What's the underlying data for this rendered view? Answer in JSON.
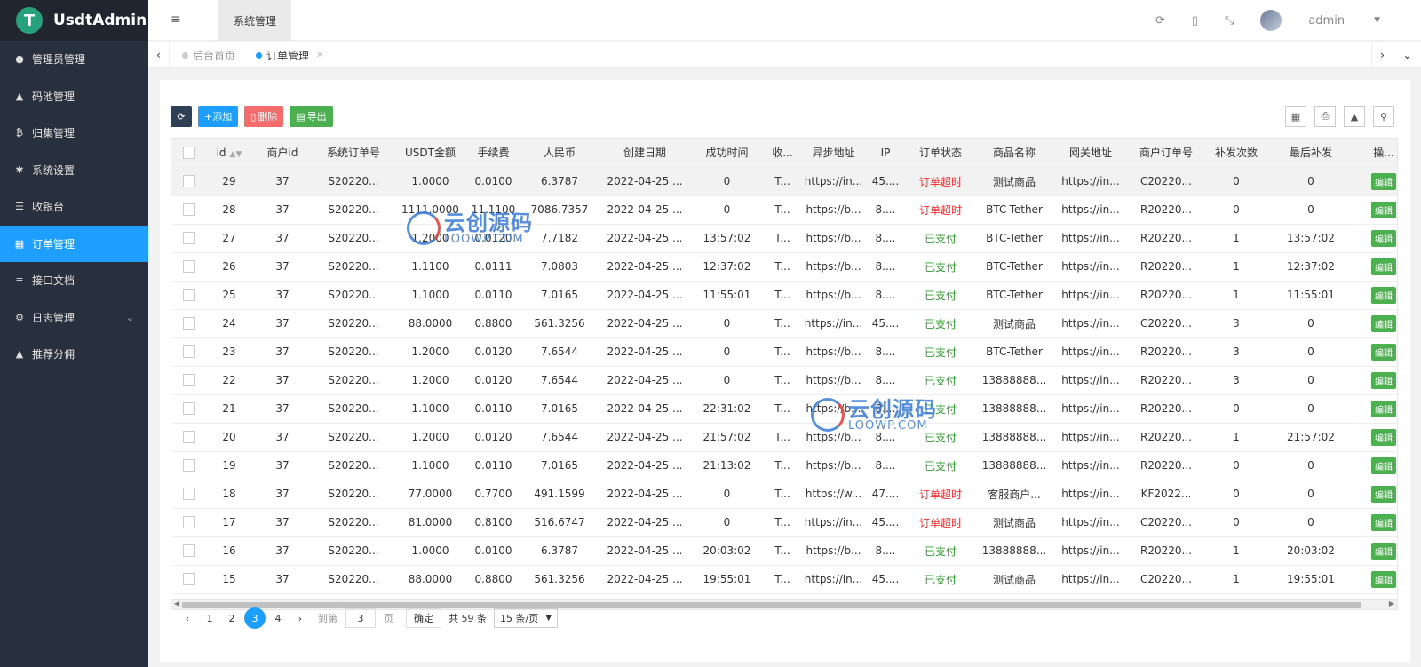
{
  "app": {
    "logo_letter": "T",
    "title": "UsdtAdmin"
  },
  "sidebar": {
    "items": [
      {
        "label": "管理员管理",
        "icon": "user-icon"
      },
      {
        "label": "码池管理",
        "icon": "android-icon"
      },
      {
        "label": "归集管理",
        "icon": "bitcoin-icon"
      },
      {
        "label": "系统设置",
        "icon": "asterisk-icon"
      },
      {
        "label": "收银台",
        "icon": "list-icon"
      },
      {
        "label": "订单管理",
        "icon": "calculator-icon"
      },
      {
        "label": "接口文档",
        "icon": "align-left-icon"
      },
      {
        "label": "日志管理",
        "icon": "gear-icon"
      },
      {
        "label": "推荐分佣",
        "icon": "android-icon"
      }
    ]
  },
  "topbar": {
    "active_tab": "系统管理",
    "username": "admin"
  },
  "tabs": [
    {
      "label": "后台首页"
    },
    {
      "label": "订单管理"
    }
  ],
  "toolbar": {
    "add": "添加",
    "delete": "删除",
    "export": "导出"
  },
  "table": {
    "columns": [
      "id",
      "商户id",
      "系统订单号",
      "USDT金额",
      "手续费",
      "人民币",
      "创建日期",
      "成功时间",
      "收...",
      "异步地址",
      "IP",
      "订单状态",
      "商品名称",
      "网关地址",
      "商户订单号",
      "补发次数",
      "最后补发",
      "操..."
    ],
    "rows": [
      [
        "29",
        "37",
        "S20220...",
        "1.0000",
        "0.0100",
        "6.3787",
        "2022-04-25 ...",
        "0",
        "T...",
        "https://in...",
        "45....",
        "订单超时",
        "测试商品",
        "https://in...",
        "C20220...",
        "0",
        "0"
      ],
      [
        "28",
        "37",
        "S20220...",
        "1111.0000",
        "11.1100",
        "7086.7357",
        "2022-04-25 ...",
        "0",
        "T...",
        "https://b...",
        "8....",
        "订单超时",
        "BTC-Tether",
        "https://in...",
        "R20220...",
        "0",
        "0"
      ],
      [
        "27",
        "37",
        "S20220...",
        "1.2000",
        "0.0120",
        "7.7182",
        "2022-04-25 ...",
        "13:57:02",
        "T...",
        "https://b...",
        "8....",
        "已支付",
        "BTC-Tether",
        "https://in...",
        "R20220...",
        "1",
        "13:57:02"
      ],
      [
        "26",
        "37",
        "S20220...",
        "1.1100",
        "0.0111",
        "7.0803",
        "2022-04-25 ...",
        "12:37:02",
        "T...",
        "https://b...",
        "8....",
        "已支付",
        "BTC-Tether",
        "https://in...",
        "R20220...",
        "1",
        "12:37:02"
      ],
      [
        "25",
        "37",
        "S20220...",
        "1.1000",
        "0.0110",
        "7.0165",
        "2022-04-25 ...",
        "11:55:01",
        "T...",
        "https://b...",
        "8....",
        "已支付",
        "BTC-Tether",
        "https://in...",
        "R20220...",
        "1",
        "11:55:01"
      ],
      [
        "24",
        "37",
        "S20220...",
        "88.0000",
        "0.8800",
        "561.3256",
        "2022-04-25 ...",
        "0",
        "T...",
        "https://in...",
        "45....",
        "已支付",
        "测试商品",
        "https://in...",
        "C20220...",
        "3",
        "0"
      ],
      [
        "23",
        "37",
        "S20220...",
        "1.2000",
        "0.0120",
        "7.6544",
        "2022-04-25 ...",
        "0",
        "T...",
        "https://b...",
        "8....",
        "已支付",
        "BTC-Tether",
        "https://in...",
        "R20220...",
        "3",
        "0"
      ],
      [
        "22",
        "37",
        "S20220...",
        "1.2000",
        "0.0120",
        "7.6544",
        "2022-04-25 ...",
        "0",
        "T...",
        "https://b...",
        "8....",
        "已支付",
        "13888888...",
        "https://in...",
        "R20220...",
        "3",
        "0"
      ],
      [
        "21",
        "37",
        "S20220...",
        "1.1000",
        "0.0110",
        "7.0165",
        "2022-04-25 ...",
        "22:31:02",
        "T...",
        "https://b...",
        "8....",
        "已支付",
        "13888888...",
        "https://in...",
        "R20220...",
        "0",
        "0"
      ],
      [
        "20",
        "37",
        "S20220...",
        "1.2000",
        "0.0120",
        "7.6544",
        "2022-04-25 ...",
        "21:57:02",
        "T...",
        "https://b...",
        "8....",
        "已支付",
        "13888888...",
        "https://in...",
        "R20220...",
        "1",
        "21:57:02"
      ],
      [
        "19",
        "37",
        "S20220...",
        "1.1000",
        "0.0110",
        "7.0165",
        "2022-04-25 ...",
        "21:13:02",
        "T...",
        "https://b...",
        "8....",
        "已支付",
        "13888888...",
        "https://in...",
        "R20220...",
        "0",
        "0"
      ],
      [
        "18",
        "37",
        "S20220...",
        "77.0000",
        "0.7700",
        "491.1599",
        "2022-04-25 ...",
        "0",
        "T...",
        "https://w...",
        "47....",
        "订单超时",
        "客服商户...",
        "https://in...",
        "KF2022...",
        "0",
        "0"
      ],
      [
        "17",
        "37",
        "S20220...",
        "81.0000",
        "0.8100",
        "516.6747",
        "2022-04-25 ...",
        "0",
        "T...",
        "https://in...",
        "45....",
        "订单超时",
        "测试商品",
        "https://in...",
        "C20220...",
        "0",
        "0"
      ],
      [
        "16",
        "37",
        "S20220...",
        "1.0000",
        "0.0100",
        "6.3787",
        "2022-04-25 ...",
        "20:03:02",
        "T...",
        "https://b...",
        "8....",
        "已支付",
        "13888888...",
        "https://in...",
        "R20220...",
        "1",
        "20:03:02"
      ],
      [
        "15",
        "37",
        "S20220...",
        "88.0000",
        "0.8800",
        "561.3256",
        "2022-04-25 ...",
        "19:55:01",
        "T...",
        "https://in...",
        "45....",
        "已支付",
        "测试商品",
        "https://in...",
        "C20220...",
        "1",
        "19:55:01"
      ]
    ],
    "op_label": "编辑"
  },
  "pager": {
    "pages": [
      "1",
      "2",
      "3",
      "4"
    ],
    "current": "3",
    "goto_label": "到第",
    "page_value": "3",
    "page_suffix": "页",
    "confirm": "确定",
    "total": "共 59 条",
    "per_page": "15 条/页"
  },
  "watermark": {
    "title": "云创源码",
    "url": "LOOWP.COM"
  },
  "colors": {
    "accent": "#1e9fff",
    "sidebar_bg": "#28303e",
    "status_timeout": "#ff2a2a",
    "status_paid": "#2e9e2e"
  }
}
